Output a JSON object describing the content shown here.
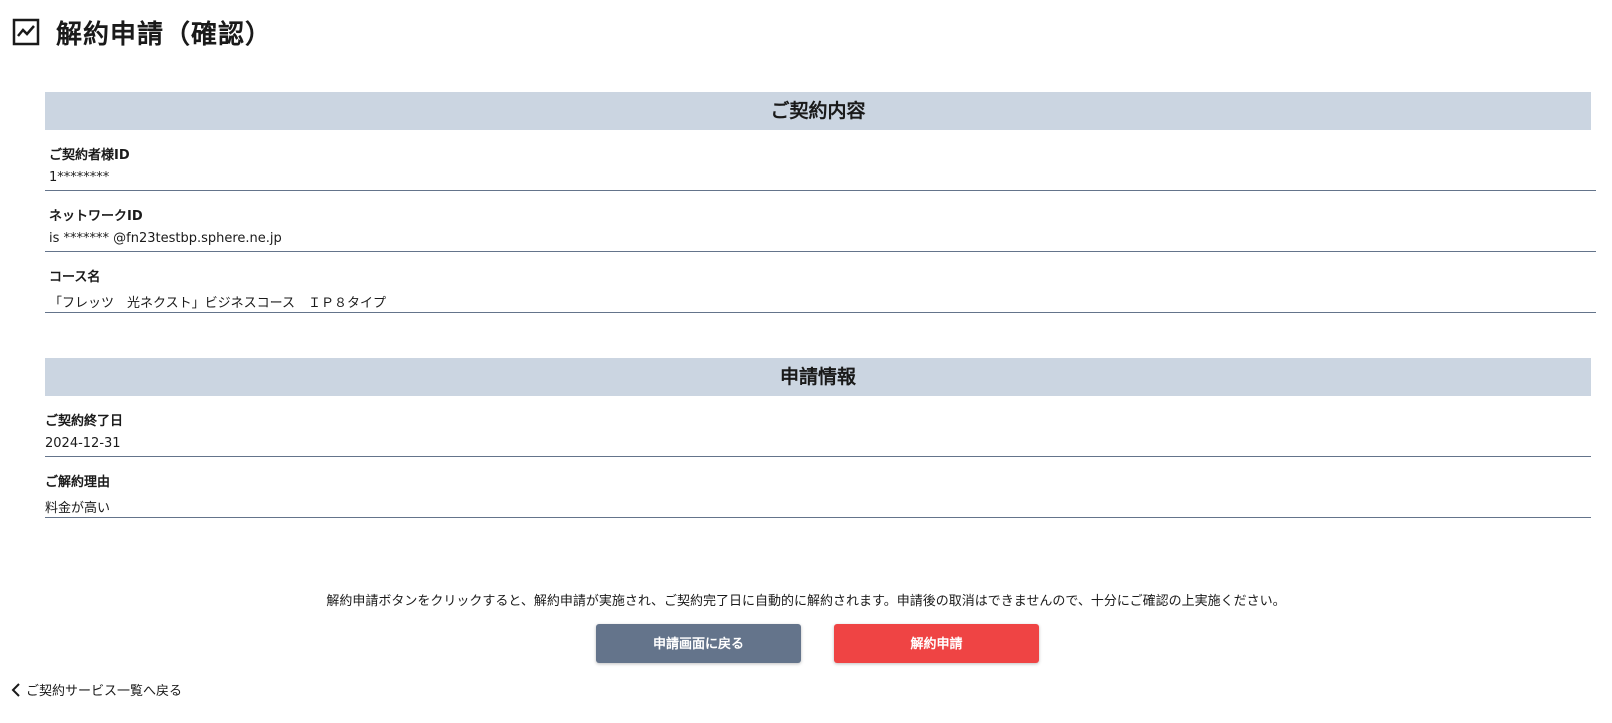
{
  "page": {
    "title": "解約申請（確認）"
  },
  "contract_section": {
    "header": "ご契約内容",
    "fields": [
      {
        "label": "ご契約者様ID",
        "value": "1********"
      },
      {
        "label": "ネットワークID",
        "value": "is ******* @fn23testbp.sphere.ne.jp"
      },
      {
        "label": "コース名",
        "value": "「フレッツ　光ネクスト」ビジネスコース　ＩＰ８タイプ"
      }
    ]
  },
  "application_section": {
    "header": "申請情報",
    "fields": [
      {
        "label": "ご契約終了日",
        "value": "2024-12-31"
      },
      {
        "label": "ご解約理由",
        "value": "料金が高い"
      }
    ]
  },
  "notice": "解約申請ボタンをクリックすると、解約申請が実施され、ご契約完了日に自動的に解約されます。申請後の取消はできませんので、十分にご確認の上実施ください。",
  "buttons": {
    "back_label": "申請画面に戻る",
    "submit_label": "解約申請"
  },
  "back_link": "ご契約サービス一覧へ戻る",
  "colors": {
    "section_header_bg": "#cbd5e1",
    "back_button": "#64748b",
    "submit_button": "#ef4444"
  },
  "icons": {
    "title_icon": "chart-line-icon",
    "back_link_icon": "chevron-left-icon"
  }
}
